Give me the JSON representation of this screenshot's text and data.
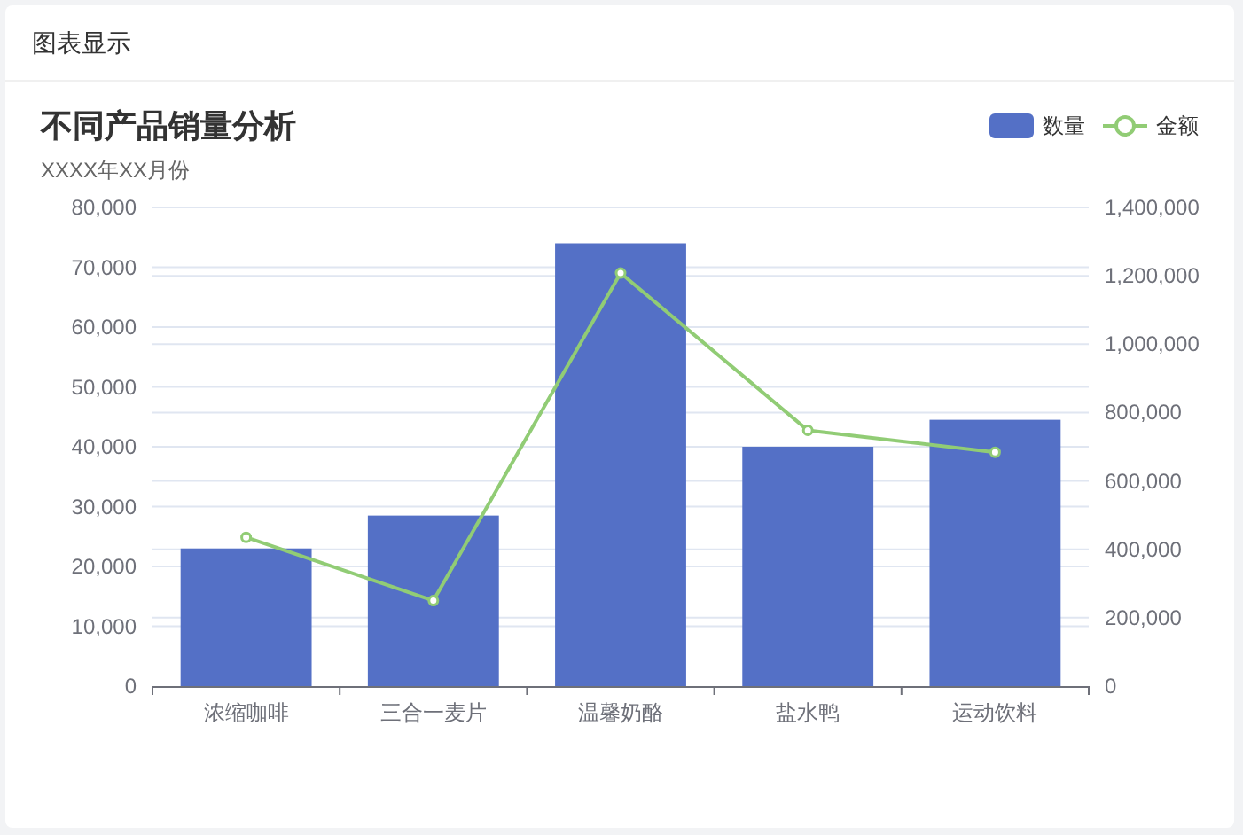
{
  "panel": {
    "title": "图表显示"
  },
  "chart": {
    "subtitle": "XXXX年XX月份",
    "chart_data": {
      "type": "bar",
      "title": "不同产品销量分析",
      "categories": [
        "浓缩咖啡",
        "三合一麦片",
        "温馨奶酪",
        "盐水鸭",
        "运动饮料"
      ],
      "series": [
        {
          "name": "数量",
          "color": "#5470c6",
          "values": [
            23000,
            28500,
            74000,
            40000,
            44500
          ]
        },
        {
          "name": "金额",
          "color": "#91cc75",
          "type": "line",
          "axis": "y2",
          "marker": "circle",
          "values": [
            435000,
            250000,
            1208000,
            748000,
            684000
          ]
        }
      ],
      "grid": true,
      "ylim": [
        0,
        80000
      ],
      "yticks": [
        {
          "value": 0,
          "label": "0"
        },
        {
          "value": 10000,
          "label": "10,000"
        },
        {
          "value": 20000,
          "label": "20,000"
        },
        {
          "value": 30000,
          "label": "30,000"
        },
        {
          "value": 40000,
          "label": "40,000"
        },
        {
          "value": 50000,
          "label": "50,000"
        },
        {
          "value": 60000,
          "label": "60,000"
        },
        {
          "value": 70000,
          "label": "70,000"
        },
        {
          "value": 80000,
          "label": "80,000"
        }
      ],
      "y2lim": [
        0,
        1400000
      ],
      "y2ticks": [
        {
          "value": 0,
          "label": "0"
        },
        {
          "value": 200000,
          "label": "200,000"
        },
        {
          "value": 400000,
          "label": "400,000"
        },
        {
          "value": 600000,
          "label": "600,000"
        },
        {
          "value": 800000,
          "label": "800,000"
        },
        {
          "value": 1000000,
          "label": "1,000,000"
        },
        {
          "value": 1200000,
          "label": "1,200,000"
        },
        {
          "value": 1400000,
          "label": "1,400,000"
        }
      ]
    }
  }
}
